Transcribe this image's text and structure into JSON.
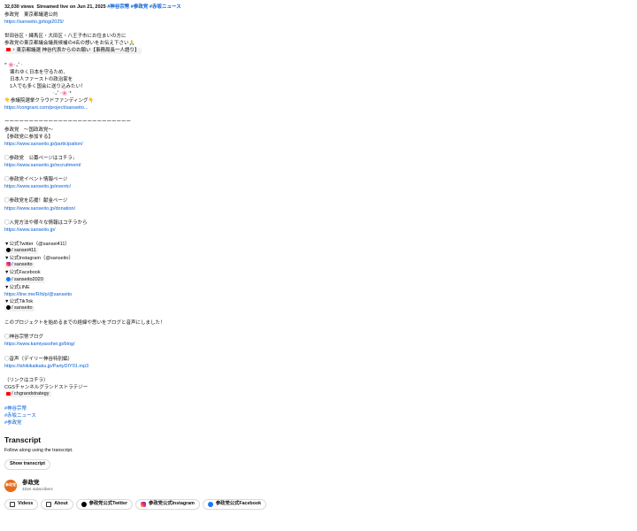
{
  "meta": {
    "views": "32,030 views",
    "streamed": "Streamed live on Jun 21, 2025",
    "tags": [
      "#神谷宗幣",
      "#参政党",
      "#赤坂ニュース"
    ]
  },
  "description": {
    "l1": "参政党　東京都議選公約",
    "l1_link": "https://sanseito.jp/togi2025/",
    "l2": "世田谷区・練馬区・大田区・八王子市にお住まいの方に",
    "l3": "参政党の東京都議会議員候補の4名の想いをお伝え下さい🙏",
    "l4": "・東京都議選 神谷代表からのお願い【事務局長一人語り】",
    "l5": "*˙🌸‧₊˚ ‧",
    "l6": "壊れゆく日本を守るため、",
    "l7": "日本人ファーストの政治家を",
    "l8": "1人でも多く国会に送り込みたい！",
    "l9": "‧₊˚ ‧🌸˙*",
    "l10": "👇参議院選挙クラウドファンディング👇",
    "l10_link": "https://congrant.com/project/sanseito...",
    "divider": "ーーーーーーーーーーーーーーーーーーーーーーーーーー",
    "l11": "参政党　〜国政政党〜",
    "l12": "【参政党に参加する】",
    "l12_link": "https://www.sanseito.jp/participation/",
    "l13": "◯参政党　公募ページはコチラ↓",
    "l13_link": "https://www.sanseito.jp/recruitment/",
    "l14": "◯参政党イベント情報ページ",
    "l14_link": "https://www.sanseito.jp/eventc/",
    "l15": "◯参政党を応援！献金ページ",
    "l15_link": "https://www.sanseito.jp/donation/",
    "l16": "◯入党方法や様々な情報はコチラから",
    "l16_link": "https://www.sanseito.jp/",
    "tw_head": "▼公式Twitter（@sansei411）",
    "tw_chip": "/ sansei411",
    "ig_head": "▼公式Instagram（@sanseito）",
    "ig_chip": "/ sanseito",
    "fb_head": "▼公式Facebook",
    "fb_chip": "/ sanseito2020",
    "line_head": "▼公式LINE",
    "line_link": "https://line.me/R/ti/p/@sanseito",
    "tt_head": "▼公式TikTok",
    "tt_chip": "/ sanseito",
    "l17": "このプロジェクトを始めるまでの経緯や思いをブログと音声にしました！",
    "l18": "◯神谷宗幣ブログ",
    "l18_link": "https://www.kamiyasohei.jp/blog/",
    "l19": "◯音声（デイリー神谷特別編）",
    "l19_link": "https://ishikikaikaku.jp/PartyDIY01.mp3",
    "l20": "（リンクはコチラ）",
    "l21": "CGSチャンネルグランドストラテジー",
    "l21_chip": "/ chgrandstrategy",
    "tag1": "#神谷宗幣",
    "tag2": "#赤坂ニュース",
    "tag3": "#参政党"
  },
  "transcript": {
    "title": "Transcript",
    "sub": "Follow along using the transcript.",
    "button": "Show transcript"
  },
  "channel": {
    "avatar_text": "参政党",
    "name": "参政党",
    "subs": "331K subscribers"
  },
  "tabs": [
    "Videos",
    "About",
    "参政党公式Twitter",
    "参政党公式Instagram",
    "参政党公式Facebook"
  ]
}
